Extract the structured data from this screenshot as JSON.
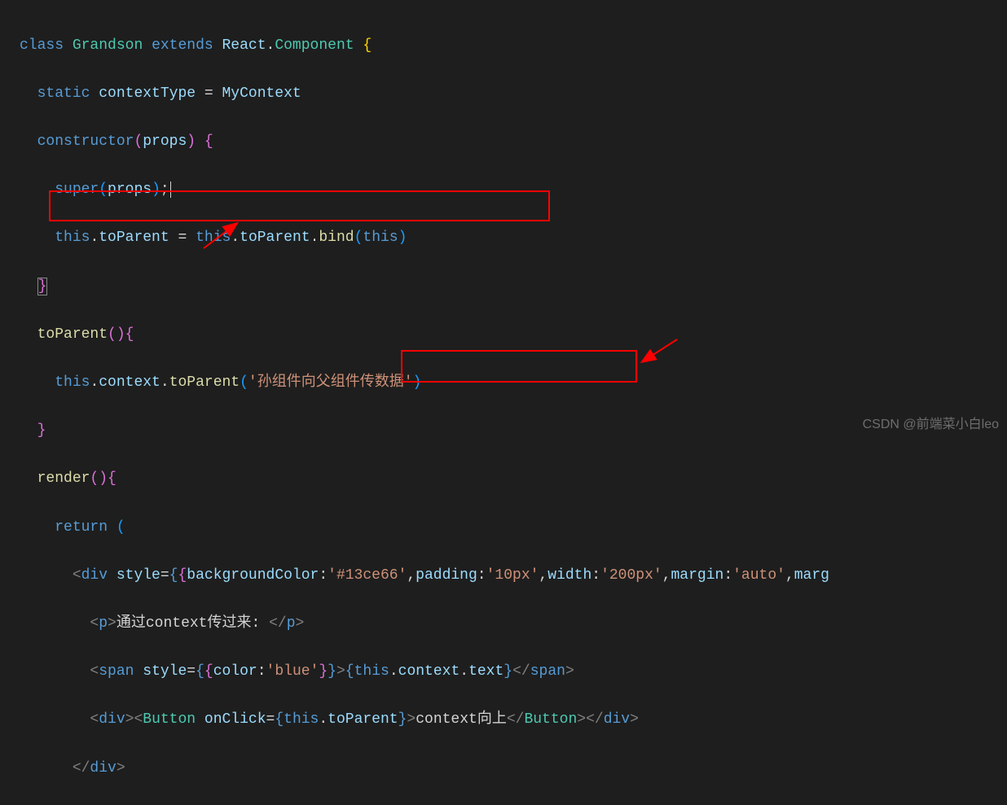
{
  "code": {
    "line1": {
      "class_kw": "class",
      "class_name": "Grandson",
      "extends_kw": "extends",
      "react": "React",
      "component": "Component"
    },
    "line2": {
      "static_kw": "static",
      "context_type": "contextType",
      "my_context": "MyContext"
    },
    "line3": {
      "constructor_kw": "constructor",
      "props": "props"
    },
    "line4": {
      "super_kw": "super",
      "props": "props"
    },
    "line5": {
      "this_kw": "this",
      "to_parent": "toParent",
      "bind": "bind"
    },
    "line7": {
      "to_parent": "toParent"
    },
    "line8": {
      "this_kw": "this",
      "context": "context",
      "to_parent": "toParent",
      "string_val": "'孙组件向父组件传数据'"
    },
    "line10": {
      "render": "render"
    },
    "line11": {
      "return_kw": "return"
    },
    "line12": {
      "div": "div",
      "style": "style",
      "bg_color": "backgroundColor",
      "bg_val": "'#13ce66'",
      "padding": "padding",
      "padding_val": "'10px'",
      "width": "width",
      "width_val": "'200px'",
      "margin": "margin",
      "margin_val": "'auto'",
      "marg": "marg"
    },
    "line13": {
      "p": "p",
      "text": "通过context传过来: "
    },
    "line14": {
      "span": "span",
      "style": "style",
      "color": "color",
      "color_val": "'blue'",
      "this_kw": "this",
      "context": "context",
      "text_prop": "text"
    },
    "line15": {
      "div": "div",
      "button": "Button",
      "onclick": "onClick",
      "this_kw": "this",
      "to_parent": "toParent",
      "btn_text": "context向上"
    },
    "line16": {
      "div": "div"
    }
  },
  "watermark": "CSDN @前端菜小白leo"
}
